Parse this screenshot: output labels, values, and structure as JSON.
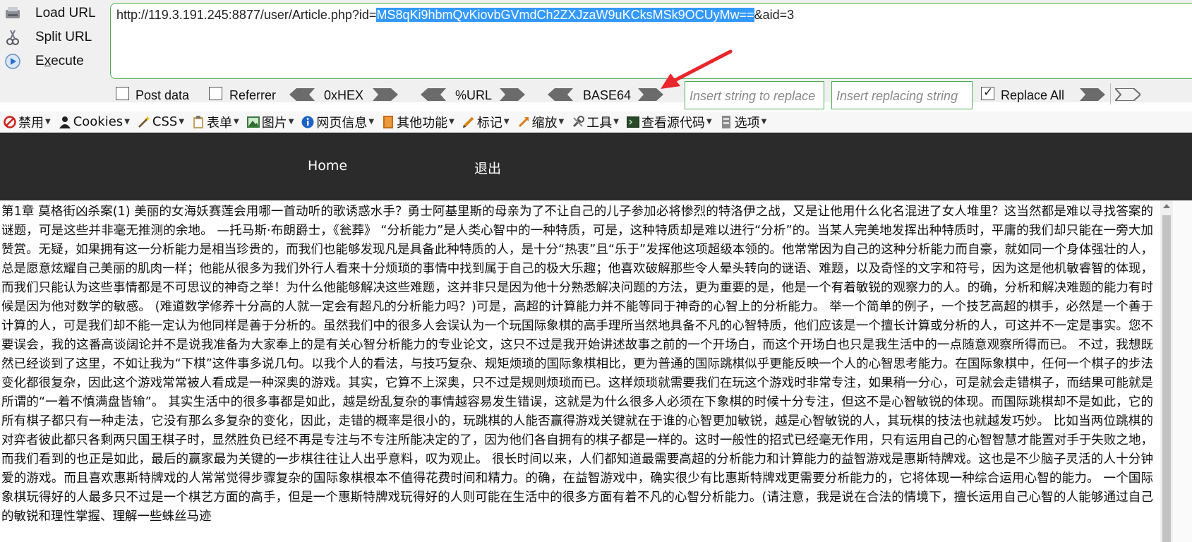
{
  "hackbar": {
    "load_url": "Load URL",
    "split_url": "Split URL",
    "execute": "Execute",
    "url": {
      "prefix": "http://119.3.191.245:8877/user/Article.php?id=",
      "selected": "MS8qKi9hbmQvKiovbGVmdCh2ZXJzaW9uKCksMSk9OCUyMw==",
      "suffix": "&aid=3"
    },
    "post_data": "Post data",
    "referrer": "Referrer",
    "hex": "0xHEX",
    "url_enc": "%URL",
    "base64": "BASE64",
    "insert_replace_placeholder": "Insert string to replace",
    "insert_replacing_placeholder": "Insert replacing string",
    "replace_all": "Replace All",
    "replace_all_checked": true,
    "post_data_checked": false,
    "referrer_checked": false
  },
  "toolbar": {
    "items": [
      "禁用",
      "Cookies",
      "CSS",
      "表单",
      "图片",
      "网页信息",
      "其他功能",
      "标记",
      "缩放",
      "工具",
      "查看源代码",
      "选项"
    ]
  },
  "nav": {
    "home": "Home",
    "logout": "退出"
  },
  "article": {
    "text": "第1章 莫格街凶杀案(1) 美丽的女海妖赛莲会用哪一首动听的歌诱惑水手？勇士阿基里斯的母亲为了不让自己的儿子参加必将惨烈的特洛伊之战，又是让他用什么化名混进了女人堆里？这当然都是难以寻找答案的谜题，可是这些并非毫无推测的余地。 —托马斯·布朗爵士，《瓮葬》 “分析能力”是人类心智中的一种特质，可是，这种特质却是难以进行“分析”的。当某人完美地发挥出种特质时，平庸的我们却只能在一旁大加赞赏。无疑，如果拥有这一分析能力是相当珍贵的，而我们也能够发现凡是具备此种特质的人，是十分“热衷”且“乐于”发挥他这项超级本领的。他常常因为自己的这种分析能力而自豪，就如同一个身体强壮的人，总是愿意炫耀自己美丽的肌肉一样；他能从很多为我们外行人看来十分烦琐的事情中找到属于自己的极大乐趣；他喜欢破解那些令人晕头转向的谜语、难题，以及奇怪的文字和符号，因为这是他机敏睿智的体现，而我们只能认为这些事情都是不可思议的神奇之举！为什么他能够解决这些难题，这并非只是因为他十分熟悉解决问题的方法，更为重要的是，他是一个有着敏锐的观察力的人。的确，分析和解决难题的能力有时候是因为他对数学的敏感。 (难道数学修养十分高的人就一定会有超凡的分析能力吗？)可是，高超的计算能力并不能等同于神奇的心智上的分析能力。 举一个简单的例子，一个技艺高超的棋手，必然是一个善于计算的人，可是我们却不能一定认为他同样是善于分析的。虽然我们中的很多人会误认为一个玩国际象棋的高手理所当然地具备不凡的心智特质，他们应该是一个擅长计算或分析的人，可这并不一定是事实。您不要误会，我的这番高谈阔论并不是说我准备为大家奉上的是有关心智分析能力的专业论文，这只不过是我开始讲述故事之前的一个开场白，而这个开场白也只是我生活中的一点随意观察所得而已。 不过，我想既然已经谈到了这里，不如让我为“下棋”这件事多说几句。以我个人的看法，与技巧复杂、规矩烦琐的国际象棋相比，更为普通的国际跳棋似乎更能反映一个人的心智思考能力。在国际象棋中，任何一个棋子的步法变化都很复杂，因此这个游戏常常被人看成是一种深奥的游戏。其实，它算不上深奥，只不过是规则烦琐而已。这样烦琐就需要我们在玩这个游戏时非常专注，如果稍一分心，可是就会走错棋子，而结果可能就是所谓的“一着不慎满盘皆输”。 其实生活中的很多事都是如此，越是纷乱复杂的事情越容易发生错误，这就是为什么很多人必须在下象棋的时候十分专注，但这不是心智敏锐的体现。而国际跳棋却不是如此，它的所有棋子都只有一种走法，它没有那么多复杂的变化，因此，走错的概率是很小的，玩跳棋的人能否赢得游戏关键就在于谁的心智更加敏锐，越是心智敏锐的人，其玩棋的技法也就越发巧妙。 比如当两位跳棋的对弈者彼此都只各剩两只国王棋子时，显然胜负已经不再是专注与不专注所能决定的了，因为他们各自拥有的棋子都是一样的。这时一般性的招式已经毫无作用，只有运用自己的心智智慧才能置对手于失败之地，而我们看到的也正是如此，最后的赢家最为关键的一步棋往往让人出乎意料，叹为观止。 很长时间以来，人们都知道最需要高超的分析能力和计算能力的益智游戏是惠斯特牌戏。这也是不少脑子灵活的人十分钟爱的游戏。而且喜欢惠斯特牌戏的人常常觉得步骤复杂的国际象棋根本不值得花费时间和精力。的确，在益智游戏中，确实很少有比惠斯特牌戏更需要分析能力的，它将体现一种综合运用心智的能力。 一个国际象棋玩得好的人最多只不过是一个棋艺方面的高手，但是一个惠斯特牌戏玩得好的人则可能在生活中的很多方面有着不凡的心智分析能力。(请注意，我是说在合法的情境下，擅长运用自己心智的人能够通过自己的敏锐和理性掌握、理解一些蛛丝马迹"
  }
}
